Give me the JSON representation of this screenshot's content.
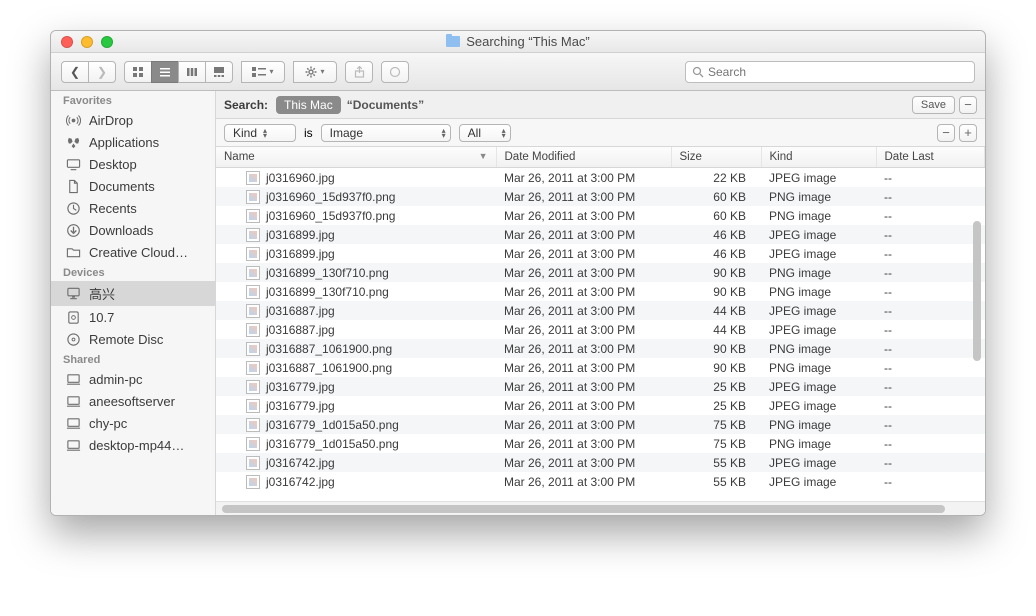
{
  "title": "Searching “This Mac”",
  "toolbar": {
    "search_placeholder": "Search"
  },
  "sidebar": {
    "sections": [
      {
        "header": "Favorites",
        "items": [
          {
            "icon": "airdrop",
            "label": "AirDrop"
          },
          {
            "icon": "applications",
            "label": "Applications"
          },
          {
            "icon": "desktop",
            "label": "Desktop"
          },
          {
            "icon": "documents",
            "label": "Documents"
          },
          {
            "icon": "recents",
            "label": "Recents"
          },
          {
            "icon": "downloads",
            "label": "Downloads"
          },
          {
            "icon": "folder",
            "label": "Creative Cloud…"
          }
        ]
      },
      {
        "header": "Devices",
        "items": [
          {
            "icon": "imac",
            "label": "高兴",
            "selected": true
          },
          {
            "icon": "disk",
            "label": "10.7"
          },
          {
            "icon": "disc",
            "label": "Remote Disc"
          }
        ]
      },
      {
        "header": "Shared",
        "items": [
          {
            "icon": "pc",
            "label": "admin-pc"
          },
          {
            "icon": "pc",
            "label": "aneesoftserver"
          },
          {
            "icon": "pc",
            "label": "chy-pc"
          },
          {
            "icon": "pc",
            "label": "desktop-mp44…"
          }
        ]
      }
    ]
  },
  "scope": {
    "label": "Search:",
    "active": "This Mac",
    "other": "“Documents”",
    "save": "Save"
  },
  "criteria": {
    "attr": "Kind",
    "op": "is",
    "value": "Image",
    "extra": "All"
  },
  "columns": {
    "name": "Name",
    "date": "Date Modified",
    "size": "Size",
    "kind": "Kind",
    "last": "Date Last"
  },
  "rows": [
    {
      "name": "j0316960.jpg",
      "date": "Mar 26, 2011 at 3:00 PM",
      "size": "22 KB",
      "kind": "JPEG image",
      "last": "--"
    },
    {
      "name": "j0316960_15d937f0.png",
      "date": "Mar 26, 2011 at 3:00 PM",
      "size": "60 KB",
      "kind": "PNG image",
      "last": "--"
    },
    {
      "name": "j0316960_15d937f0.png",
      "date": "Mar 26, 2011 at 3:00 PM",
      "size": "60 KB",
      "kind": "PNG image",
      "last": "--"
    },
    {
      "name": "j0316899.jpg",
      "date": "Mar 26, 2011 at 3:00 PM",
      "size": "46 KB",
      "kind": "JPEG image",
      "last": "--"
    },
    {
      "name": "j0316899.jpg",
      "date": "Mar 26, 2011 at 3:00 PM",
      "size": "46 KB",
      "kind": "JPEG image",
      "last": "--"
    },
    {
      "name": "j0316899_130f710.png",
      "date": "Mar 26, 2011 at 3:00 PM",
      "size": "90 KB",
      "kind": "PNG image",
      "last": "--"
    },
    {
      "name": "j0316899_130f710.png",
      "date": "Mar 26, 2011 at 3:00 PM",
      "size": "90 KB",
      "kind": "PNG image",
      "last": "--"
    },
    {
      "name": "j0316887.jpg",
      "date": "Mar 26, 2011 at 3:00 PM",
      "size": "44 KB",
      "kind": "JPEG image",
      "last": "--"
    },
    {
      "name": "j0316887.jpg",
      "date": "Mar 26, 2011 at 3:00 PM",
      "size": "44 KB",
      "kind": "JPEG image",
      "last": "--"
    },
    {
      "name": "j0316887_1061900.png",
      "date": "Mar 26, 2011 at 3:00 PM",
      "size": "90 KB",
      "kind": "PNG image",
      "last": "--"
    },
    {
      "name": "j0316887_1061900.png",
      "date": "Mar 26, 2011 at 3:00 PM",
      "size": "90 KB",
      "kind": "PNG image",
      "last": "--"
    },
    {
      "name": "j0316779.jpg",
      "date": "Mar 26, 2011 at 3:00 PM",
      "size": "25 KB",
      "kind": "JPEG image",
      "last": "--"
    },
    {
      "name": "j0316779.jpg",
      "date": "Mar 26, 2011 at 3:00 PM",
      "size": "25 KB",
      "kind": "JPEG image",
      "last": "--"
    },
    {
      "name": "j0316779_1d015a50.png",
      "date": "Mar 26, 2011 at 3:00 PM",
      "size": "75 KB",
      "kind": "PNG image",
      "last": "--"
    },
    {
      "name": "j0316779_1d015a50.png",
      "date": "Mar 26, 2011 at 3:00 PM",
      "size": "75 KB",
      "kind": "PNG image",
      "last": "--"
    },
    {
      "name": "j0316742.jpg",
      "date": "Mar 26, 2011 at 3:00 PM",
      "size": "55 KB",
      "kind": "JPEG image",
      "last": "--"
    },
    {
      "name": "j0316742.jpg",
      "date": "Mar 26, 2011 at 3:00 PM",
      "size": "55 KB",
      "kind": "JPEG image",
      "last": "--"
    }
  ]
}
